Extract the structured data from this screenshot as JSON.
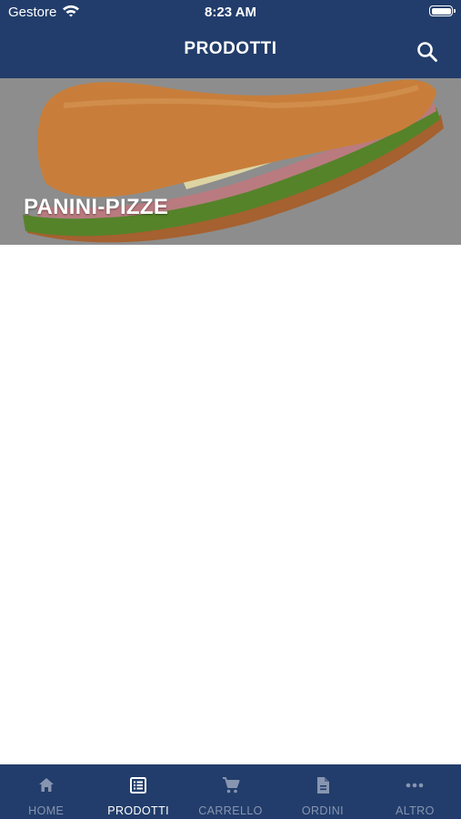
{
  "status_bar": {
    "carrier": "Gestore",
    "time": "8:23 AM"
  },
  "header": {
    "title": "PRODOTTI"
  },
  "categories": [
    {
      "label": "PANINI-PIZZE"
    }
  ],
  "tab_bar": {
    "tabs": [
      {
        "label": "HOME",
        "icon": "home-icon",
        "active": false
      },
      {
        "label": "PRODOTTI",
        "icon": "list-icon",
        "active": true
      },
      {
        "label": "CARRELLO",
        "icon": "cart-icon",
        "active": false
      },
      {
        "label": "ORDINI",
        "icon": "document-icon",
        "active": false
      },
      {
        "label": "ALTRO",
        "icon": "more-icon",
        "active": false
      }
    ]
  },
  "colors": {
    "primary": "#223d6b",
    "tab_inactive": "#8795b0",
    "tab_active": "#ffffff"
  }
}
